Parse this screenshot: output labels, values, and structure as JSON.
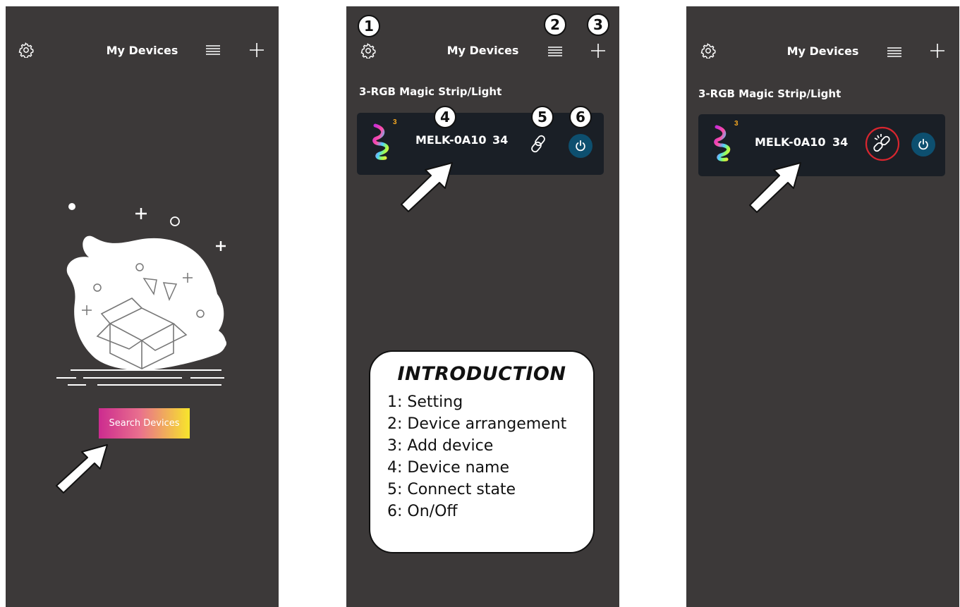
{
  "screens": [
    {
      "header": {
        "title": "My Devices",
        "settings_icon": "gear-icon",
        "arrange_icon": "list-icon",
        "add_icon": "plus-icon"
      },
      "empty_state": {
        "illustration": "open-box-illustration"
      },
      "search_button": {
        "label": "Search Devices"
      }
    },
    {
      "header": {
        "title": "My Devices",
        "settings_icon": "gear-icon",
        "arrange_icon": "list-icon",
        "add_icon": "plus-icon"
      },
      "section_label": "3-RGB Magic Strip/Light",
      "device": {
        "name": "MELK-0A10",
        "number": "34",
        "strip_badge": "3",
        "connect_icon": "link-icon",
        "power_icon": "power-icon"
      },
      "callouts": [
        "1",
        "2",
        "3",
        "4",
        "5",
        "6"
      ],
      "introduction": {
        "title": "INTRODUCTION",
        "items": [
          "1: Setting",
          "2: Device arrangement",
          "3: Add device",
          "4: Device name",
          "5: Connect state",
          "6: On/Off"
        ]
      }
    },
    {
      "header": {
        "title": "My Devices",
        "settings_icon": "gear-icon",
        "arrange_icon": "list-icon",
        "add_icon": "plus-icon"
      },
      "section_label": "3-RGB Magic Strip/Light",
      "device": {
        "name": "MELK-0A10",
        "number": "34",
        "strip_badge": "3",
        "connect_icon": "broken-link-icon",
        "power_icon": "power-icon"
      }
    }
  ],
  "colors": {
    "phone_bg": "#3c3939",
    "card_bg": "#1a1f26",
    "power_bg": "#0d4f6f",
    "highlight_ring": "#d8262f",
    "strip_badge": "#f6a821",
    "search_gradient": [
      "#cc2b8f",
      "#f7e52b"
    ]
  }
}
